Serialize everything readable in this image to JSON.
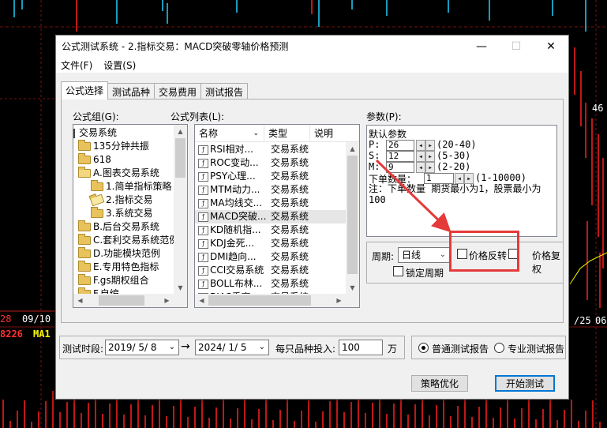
{
  "background": {
    "left_date_labels": [
      "28",
      "09/10"
    ],
    "right_date_label": "/25",
    "right_date_label2": "06",
    "left_price": "8226",
    "ma_label": "MA1",
    "right_price": "46"
  },
  "window": {
    "title": "公式测试系统 - 2.指标交易：MACD突破零轴价格预测",
    "minimize": "—",
    "maximize": "☐",
    "close": "✕"
  },
  "menu": [
    "文件(F)",
    "设置(S)"
  ],
  "tabs": [
    "公式选择",
    "测试品种",
    "交易费用",
    "测试报告"
  ],
  "formula_group": {
    "label": "公式组(G):",
    "items": [
      {
        "text": "交易系统",
        "level": 0,
        "icon": "none"
      },
      {
        "text": "135分钟共振",
        "level": 1,
        "icon": "folder"
      },
      {
        "text": "618",
        "level": 1,
        "icon": "folder"
      },
      {
        "text": "A.图表交易系统",
        "level": 1,
        "icon": "folder-open"
      },
      {
        "text": "1.简单指标策略",
        "level": 2,
        "icon": "folder"
      },
      {
        "text": "2.指标交易",
        "level": 2,
        "icon": "folder-selected"
      },
      {
        "text": "3.系统交易",
        "level": 2,
        "icon": "folder"
      },
      {
        "text": "B.后台交易系统",
        "level": 1,
        "icon": "folder"
      },
      {
        "text": "C.套利交易系统范例",
        "level": 1,
        "icon": "folder"
      },
      {
        "text": "D.功能模块范例",
        "level": 1,
        "icon": "folder"
      },
      {
        "text": "E.专用特色指标",
        "level": 1,
        "icon": "folder"
      },
      {
        "text": "F.gs期权组合",
        "level": 1,
        "icon": "folder"
      },
      {
        "text": "F.自编",
        "level": 1,
        "icon": "folder"
      }
    ]
  },
  "formula_list": {
    "label": "公式列表(L):",
    "columns": [
      "名称",
      "类型",
      "说明"
    ],
    "rows": [
      {
        "name": "RSI相对...",
        "type": "交易系统"
      },
      {
        "name": "ROC变动...",
        "type": "交易系统"
      },
      {
        "name": "PSY心理...",
        "type": "交易系统"
      },
      {
        "name": "MTM动力...",
        "type": "交易系统"
      },
      {
        "name": "MA均线交...",
        "type": "交易系统"
      },
      {
        "name": "MACD突破...",
        "type": "交易系统"
      },
      {
        "name": "KD随机指...",
        "type": "交易系统"
      },
      {
        "name": "KDJ金死...",
        "type": "交易系统"
      },
      {
        "name": "DMI趋向...",
        "type": "交易系统"
      },
      {
        "name": "CCI交易系统",
        "type": "交易系统"
      },
      {
        "name": "BOLL布林...",
        "type": "交易系统"
      },
      {
        "name": "BIAS乖离...",
        "type": "交易系统"
      }
    ],
    "selected_index": 5
  },
  "params": {
    "label": "参数(P):",
    "heading": "默认参数",
    "p": {
      "key": "P:",
      "value": "26",
      "range": "(20-40)"
    },
    "s": {
      "key": "S:",
      "value": "12",
      "range": "(5-30)"
    },
    "m": {
      "key": "M:",
      "value": "9",
      "range": "(2-20)"
    },
    "order_qty": {
      "label": "下单数量：",
      "value": "1",
      "range": "(1-10000)"
    },
    "note": "注：下单数量 期货最小为1，股票最小为100"
  },
  "options": {
    "period_label": "周期:",
    "period_value": "日线",
    "price_reverse": "价格反转",
    "price_restore": "价格复权",
    "lock_period": "锁定周期"
  },
  "test_period": {
    "label": "测试时段:",
    "start": "2019/ 5/ 8",
    "arrow": "→",
    "end": "2024/ 1/ 5",
    "invest_label": "每只品种投入:",
    "invest_value": "100",
    "unit": "万"
  },
  "report": {
    "normal": "普通测试报告",
    "pro": "专业测试报告",
    "selected": "normal"
  },
  "buttons": {
    "optimize": "策略优化",
    "start": "开始测试"
  },
  "colors": {
    "annotation_red": "#e53a3a",
    "accent_blue": "#0078d7",
    "chart_red": "#ff2020",
    "chart_yellow": "#ffff00"
  }
}
